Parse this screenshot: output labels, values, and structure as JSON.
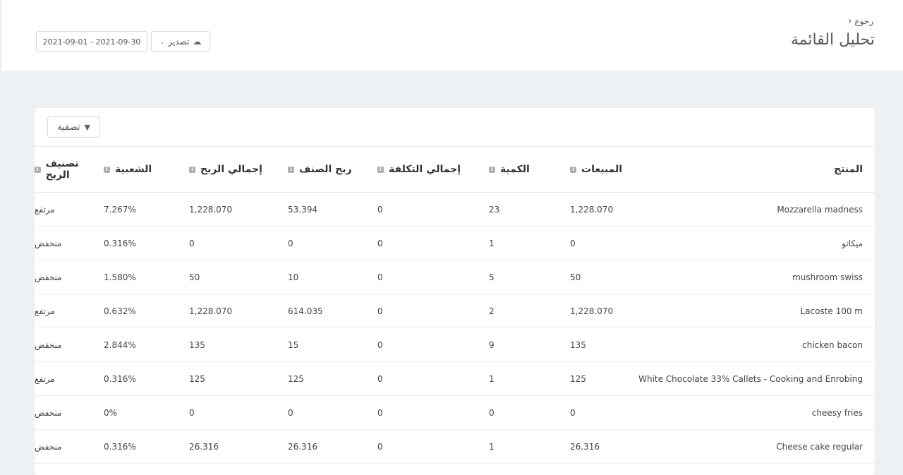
{
  "header": {
    "back_label": "رجوع",
    "title": "تحليل القائمة",
    "date_range": "2021-09-01 - 2021-09-30",
    "export_label": "تصدير"
  },
  "toolbar": {
    "filter_label": "تصفية"
  },
  "table": {
    "columns": [
      "المنتج",
      "المبيعات",
      "الكمية",
      "إجمالي التكلفة",
      "ربح الصنف",
      "إجمالي الربح",
      "الشعبية",
      "تصنيف الربح"
    ],
    "rows": [
      [
        "Mozzarella madness",
        "1,228.070",
        "23",
        "0",
        "53.394",
        "1,228.070",
        "7.267%",
        "مرتفع"
      ],
      [
        "ميكاتو",
        "0",
        "1",
        "0",
        "0",
        "0",
        "0.316%",
        "منخفض"
      ],
      [
        "mushroom swiss",
        "50",
        "5",
        "0",
        "10",
        "50",
        "1.580%",
        "منخفض"
      ],
      [
        "Lacoste 100 m",
        "1,228.070",
        "2",
        "0",
        "614.035",
        "1,228.070",
        "0.632%",
        "مرتفع"
      ],
      [
        "chicken bacon",
        "135",
        "9",
        "0",
        "15",
        "135",
        "2.844%",
        "منخفض"
      ],
      [
        "White Chocolate 33% Callets - Cooking and Enrobing",
        "125",
        "1",
        "0",
        "125",
        "125",
        "0.316%",
        "مرتفع"
      ],
      [
        "cheesy fries",
        "0",
        "0",
        "0",
        "0",
        "0",
        "0%",
        "منخفض"
      ],
      [
        "Cheese cake regular",
        "26.316",
        "1",
        "0",
        "26.316",
        "26.316",
        "0.316%",
        "منخفض"
      ]
    ]
  },
  "icons": {
    "back": "chevron-left-icon",
    "export": "cloud-icon",
    "export_caret": "chevron-down-icon",
    "filter": "funnel-icon",
    "column_info": "info-icon"
  },
  "colors": {
    "page_bg": "#eef1f4",
    "card_bg": "#ffffff",
    "border": "#d5d8dc",
    "info_badge": "#aab0b6"
  }
}
